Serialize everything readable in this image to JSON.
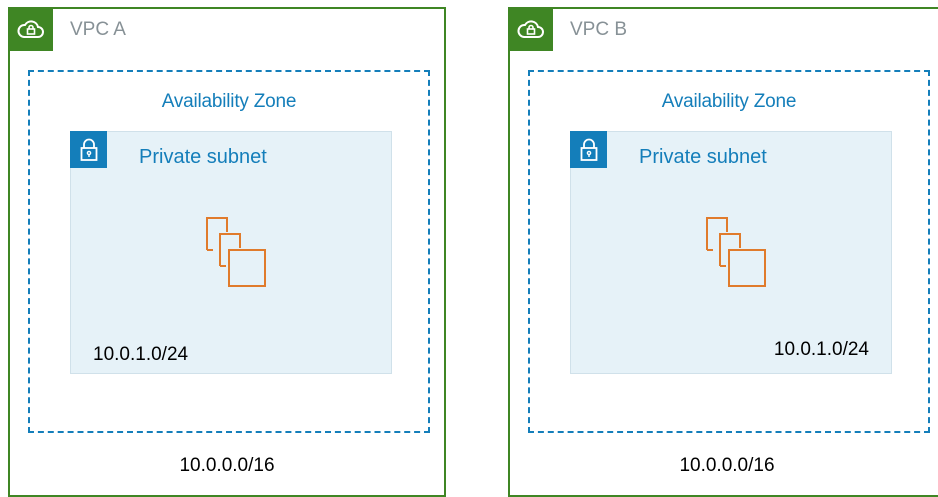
{
  "vpcs": [
    {
      "title": "VPC A",
      "cidr": "10.0.0.0/16",
      "availability_zone": {
        "label": "Availability Zone",
        "subnet": {
          "title": "Private subnet",
          "cidr": "10.0.1.0/24"
        }
      }
    },
    {
      "title": "VPC B",
      "cidr": "10.0.0.0/16",
      "availability_zone": {
        "label": "Availability Zone",
        "subnet": {
          "title": "Private subnet",
          "cidr": "10.0.1.0/24"
        }
      }
    }
  ],
  "icons": {
    "vpc": "cloud-lock-icon",
    "subnet": "padlock-icon",
    "instances": "ec2-instances-icon"
  },
  "colors": {
    "vpc_border": "#3f8624",
    "vpc_title": "#879196",
    "az_border": "#147eba",
    "subnet_bg": "#e6f2f8",
    "subnet_badge": "#147eba",
    "instances_stroke": "#e07b2c"
  }
}
